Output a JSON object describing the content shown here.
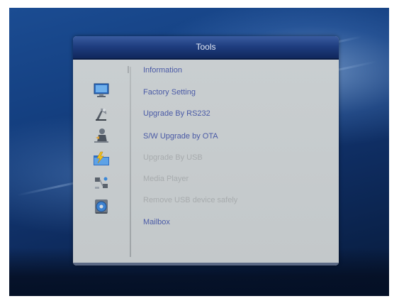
{
  "dialog": {
    "title": "Tools",
    "menu_items": [
      {
        "label": "Information",
        "enabled": true
      },
      {
        "label": "Factory Setting",
        "enabled": true
      },
      {
        "label": "Upgrade By RS232",
        "enabled": true
      },
      {
        "label": "S/W Upgrade by OTA",
        "enabled": true
      },
      {
        "label": "Upgrade By USB",
        "enabled": false
      },
      {
        "label": "Media Player",
        "enabled": false
      },
      {
        "label": "Remove USB device safely",
        "enabled": false
      },
      {
        "label": "Mailbox",
        "enabled": true
      }
    ],
    "icons": [
      "monitor-icon",
      "satellite-dish-icon",
      "tools-upgrade-icon",
      "folder-lightning-icon",
      "network-icon",
      "disc-icon"
    ]
  },
  "colors": {
    "header": "#1f3e80",
    "panel": "#c6cbcd",
    "enabled_text": "#4a5aa6",
    "disabled_text": "#a7abad"
  }
}
